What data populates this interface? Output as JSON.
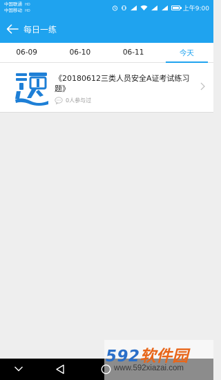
{
  "status_bar": {
    "carrier_1": "中国联通",
    "carrier_2": "中国移动",
    "time": "上午9:00"
  },
  "header": {
    "title": "每日一练",
    "back_icon": "arrow-left-icon"
  },
  "tabs": [
    {
      "label": "06-09",
      "active": false
    },
    {
      "label": "06-10",
      "active": false
    },
    {
      "label": "06-11",
      "active": false
    },
    {
      "label": "今天",
      "active": true
    }
  ],
  "items": [
    {
      "title": "《20180612三类人员安全A证考试练习题》",
      "participants": "0人参与过",
      "thumb_icon": "question-ti-icon"
    }
  ],
  "watermark": {
    "digits": "592",
    "text": "软件园",
    "url": "www.592xiazai.com"
  },
  "colors": {
    "primary": "#1fa3ef",
    "background": "#eeeeee"
  }
}
